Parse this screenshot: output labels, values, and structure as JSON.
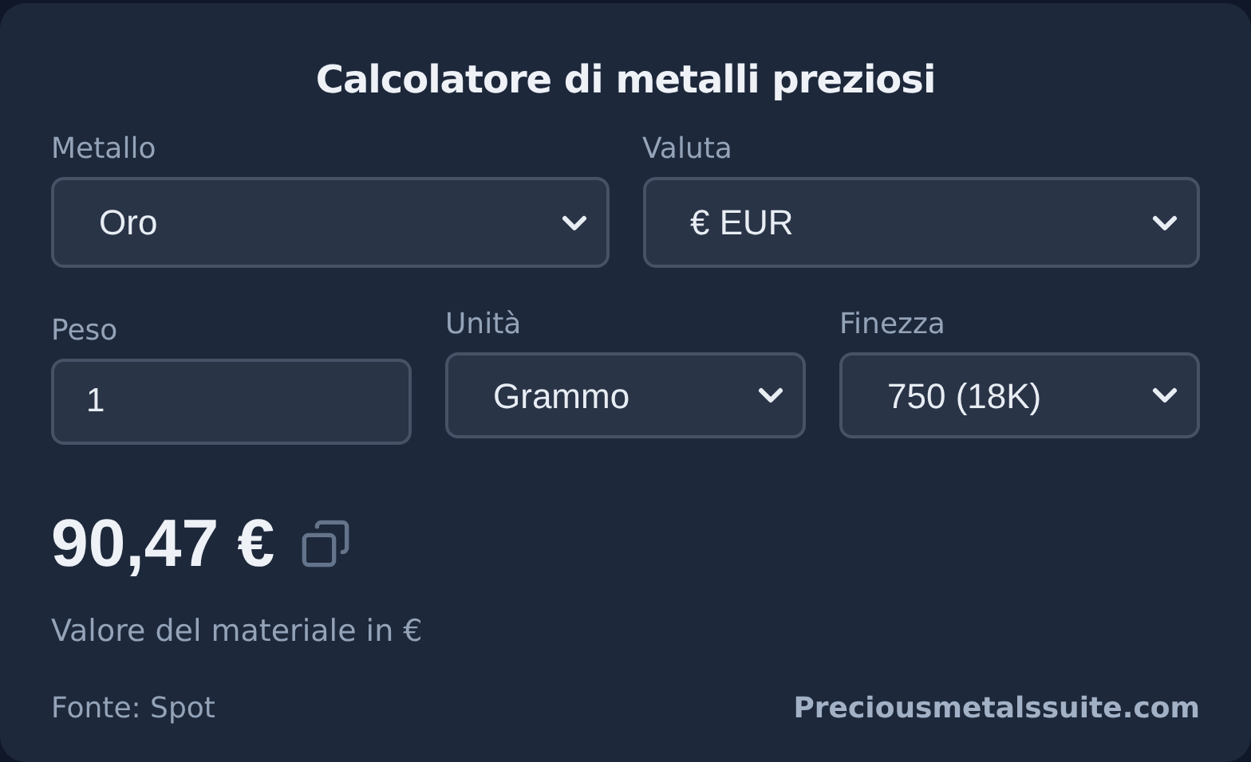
{
  "title": "Calcolatore di metalli preziosi",
  "rows": [
    [
      {
        "kind": "select",
        "label": "Metallo",
        "value": "Oro"
      },
      {
        "kind": "select",
        "label": "Valuta",
        "value": "€ EUR"
      }
    ],
    [
      {
        "kind": "input",
        "label": "Peso",
        "value": "1"
      },
      {
        "kind": "select",
        "label": "Unità",
        "value": "Grammo"
      },
      {
        "kind": "select",
        "label": "Finezza",
        "value": "750 (18K)"
      }
    ]
  ],
  "result": {
    "value": "90,47 €",
    "caption": "Valore del materiale in €"
  },
  "footer": {
    "source": "Fonte: Spot",
    "link": "Preciousmetalssuite.com"
  }
}
